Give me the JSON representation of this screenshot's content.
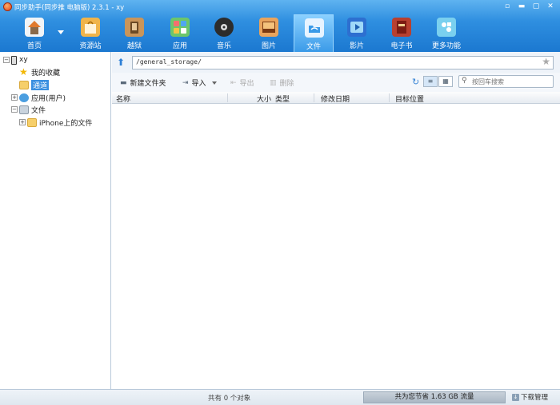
{
  "window": {
    "title": "同步助手(同步推 电脑版) 2.3.1 - xy",
    "buttons": [
      "▫",
      "▬",
      "▢",
      "✕"
    ]
  },
  "toolbar": {
    "items": [
      {
        "label": "首页",
        "icon": "home-icon",
        "color": "#f1f4f7"
      },
      {
        "label": "资源站",
        "icon": "shop-bag-icon",
        "color": "#f0b44a"
      },
      {
        "label": "越狱",
        "icon": "jailbreak-icon",
        "color": "#c9955a"
      },
      {
        "label": "应用",
        "icon": "apps-icon",
        "color": "#6cc66c"
      },
      {
        "label": "音乐",
        "icon": "music-icon",
        "color": "#2c2c2c"
      },
      {
        "label": "图片",
        "icon": "photo-icon",
        "color": "#e9a45d"
      },
      {
        "label": "文件",
        "icon": "folder-icon",
        "color": "#3a9ae8"
      },
      {
        "label": "影片",
        "icon": "video-icon",
        "color": "#2d6fd0"
      },
      {
        "label": "电子书",
        "icon": "ebook-icon",
        "color": "#b8402f"
      },
      {
        "label": "更多功能",
        "icon": "more-icon",
        "color": "#7ad0ef"
      }
    ],
    "active_index": 6
  },
  "tree": {
    "root": "xy",
    "favorites": "我的收藏",
    "current": "通道",
    "apps": "应用(用户)",
    "files": "文件",
    "iphone_files": "iPhone上的文件"
  },
  "path": {
    "value": "/general_storage/"
  },
  "actions": {
    "new_folder": "新建文件夹",
    "import": "导入",
    "export": "导出",
    "delete": "删除",
    "search_placeholder": "按回车搜索"
  },
  "columns": {
    "name": "名称",
    "size": "大小",
    "type": "类型",
    "modified": "修改日期",
    "target": "目标位置"
  },
  "status": {
    "count": "共有 0 个对象",
    "traffic": "共为您节省 1.63 GB 流量",
    "download": "下载管理"
  }
}
